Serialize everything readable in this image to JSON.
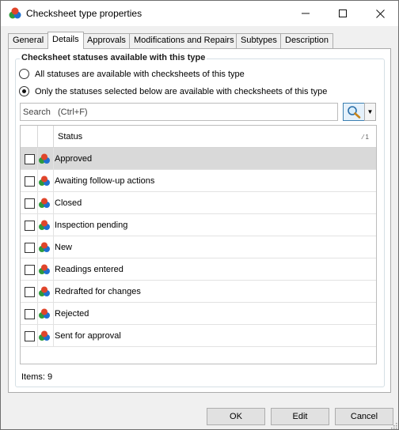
{
  "window": {
    "title": "Checksheet type properties",
    "controls": {
      "minimize": "—",
      "maximize": "☐",
      "close": "✕"
    }
  },
  "tabs": [
    {
      "label": "General",
      "active": false
    },
    {
      "label": "Details",
      "active": true
    },
    {
      "label": "Approvals",
      "active": false
    },
    {
      "label": "Modifications and Repairs",
      "active": false
    },
    {
      "label": "Subtypes",
      "active": false
    },
    {
      "label": "Description",
      "active": false
    }
  ],
  "group": {
    "title": "Checksheet statuses available with this type",
    "options": [
      {
        "label": "All statuses are available with checksheets of this type",
        "checked": false
      },
      {
        "label": "Only the statuses selected below are available with checksheets of this type",
        "checked": true
      }
    ]
  },
  "search": {
    "placeholder": "Search   (Ctrl+F)",
    "value": ""
  },
  "grid": {
    "header": {
      "status": "Status",
      "sort_indicator": "⁄ 1"
    },
    "rows": [
      {
        "label": "Approved",
        "checked": false,
        "selected": true
      },
      {
        "label": "Awaiting follow-up actions",
        "checked": false,
        "selected": false
      },
      {
        "label": "Closed",
        "checked": false,
        "selected": false
      },
      {
        "label": "Inspection pending",
        "checked": false,
        "selected": false
      },
      {
        "label": "New",
        "checked": false,
        "selected": false
      },
      {
        "label": "Readings entered",
        "checked": false,
        "selected": false
      },
      {
        "label": "Redrafted for changes",
        "checked": false,
        "selected": false
      },
      {
        "label": "Rejected",
        "checked": false,
        "selected": false
      },
      {
        "label": "Sent for approval",
        "checked": false,
        "selected": false
      }
    ]
  },
  "items_count": "Items: 9",
  "buttons": {
    "ok": "OK",
    "edit": "Edit",
    "cancel": "Cancel"
  },
  "icons": {
    "app": "checksheet-type-icon",
    "row": "status-icon",
    "search": "search-magnifier-icon"
  },
  "colors": {
    "selected_row": "#d9d9d9",
    "accent": "#3c7fb1"
  }
}
